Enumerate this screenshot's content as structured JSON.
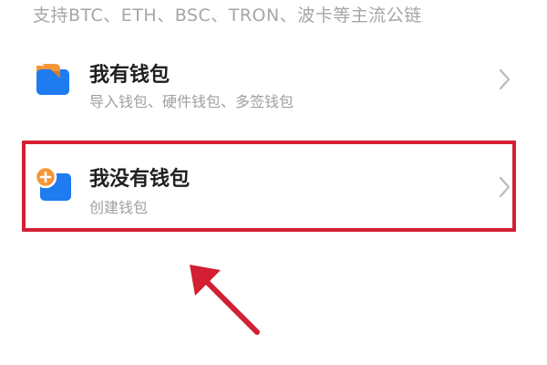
{
  "header": {
    "supported_chains": "支持BTC、ETH、BSC、TRON、波卡等主流公链"
  },
  "options": [
    {
      "title": "我有钱包",
      "description": "导入钱包、硬件钱包、多签钱包",
      "icon": "wallet-import-icon"
    },
    {
      "title": "我没有钱包",
      "description": "创建钱包",
      "icon": "wallet-create-icon"
    }
  ],
  "annotation": {
    "highlight_color": "#d21f32"
  },
  "colors": {
    "icon_blue": "#1e7bf0",
    "icon_orange": "#f5953a",
    "text_primary": "#1f1f1f",
    "text_secondary": "#a0a0a0"
  }
}
